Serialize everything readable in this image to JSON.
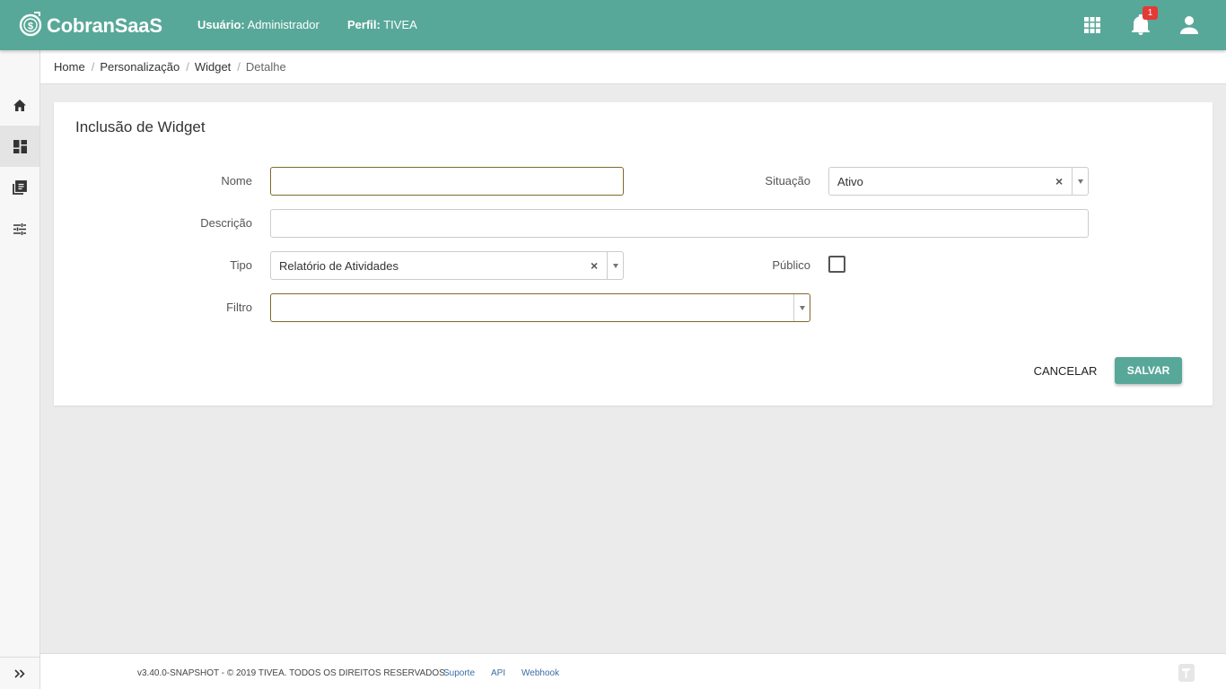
{
  "header": {
    "logo_text": "CobranSaaS",
    "user_label": "Usuário:",
    "user_value": "Administrador",
    "profile_label": "Perfil:",
    "profile_value": "TIVEA",
    "notification_count": "1",
    "icons": [
      "apps-grid-icon",
      "bell-icon",
      "user-icon"
    ]
  },
  "sidebar": {
    "items": [
      {
        "icon": "home-icon",
        "active": false
      },
      {
        "icon": "dashboard-icon",
        "active": true
      },
      {
        "icon": "library-icon",
        "active": false
      },
      {
        "icon": "sliders-icon",
        "active": false
      }
    ],
    "expand_icon": "double-chevron-right-icon"
  },
  "breadcrumb": [
    "Home",
    "Personalização",
    "Widget",
    "Detalhe"
  ],
  "form": {
    "title": "Inclusão de Widget",
    "nome_label": "Nome",
    "nome_value": "",
    "situacao_label": "Situação",
    "situacao_value": "Ativo",
    "descricao_label": "Descrição",
    "descricao_value": "",
    "tipo_label": "Tipo",
    "tipo_value": "Relatório de Atividades",
    "publico_label": "Público",
    "publico_checked": false,
    "filtro_label": "Filtro",
    "filtro_value": "",
    "clear_glyph": "×",
    "cancel_label": "CANCELAR",
    "save_label": "SALVAR"
  },
  "footer": {
    "copyright": "v3.40.0-SNAPSHOT - © 2019 TIVEA. TODOS OS DIREITOS RESERVADOS.",
    "links": [
      "Suporte",
      "API",
      "Webhook"
    ]
  },
  "colors": {
    "primary": "#58a899",
    "focus_border": "#7e6a2d",
    "badge": "#e53935",
    "link": "#3a6ea5"
  }
}
